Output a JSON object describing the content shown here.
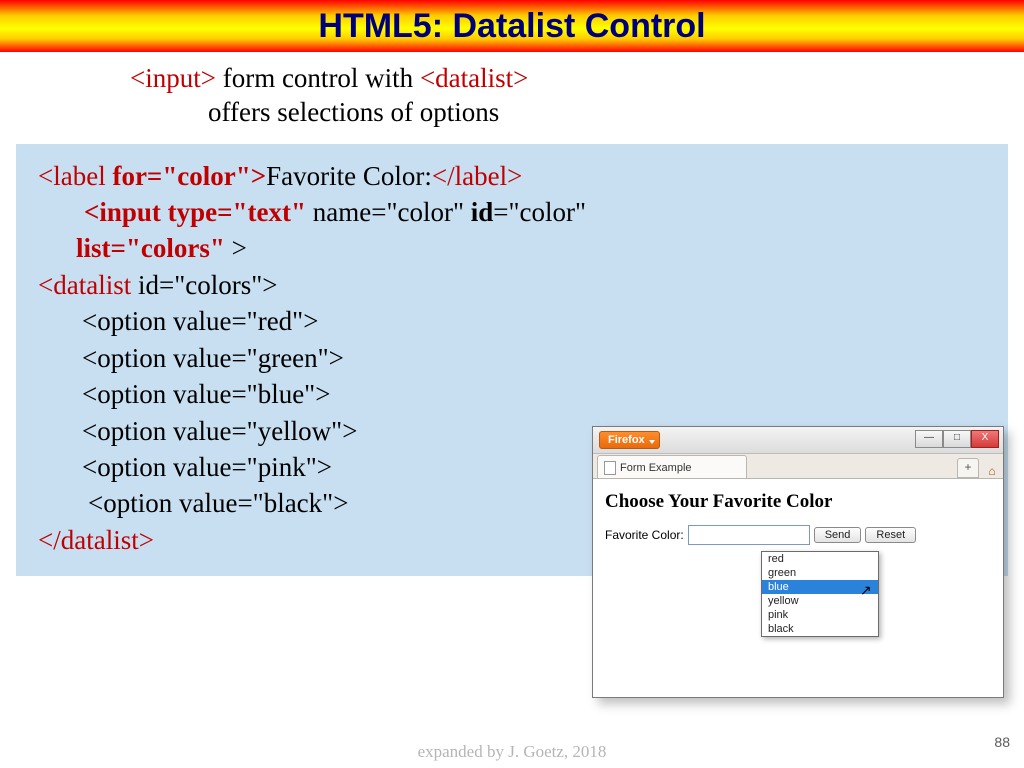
{
  "title": "HTML5: Datalist Control",
  "subtitle": {
    "pre": "<input>",
    "mid1": " form control with ",
    "tag2": "<datalist>",
    "line2": "offers selections of options"
  },
  "code": {
    "l1a": "<label",
    "l1b": " for=\"color\">",
    "l1c": "Favorite Color:",
    "l1d": "</label>",
    "l2a": "<input type=\"text\"",
    "l2b": " name=\"color\" ",
    "l2c": "id",
    "l2d": "=\"color\" ",
    "l3a": "list=\"colors\"",
    "l3b": " >",
    "l4a": "<datalist",
    "l4b": " id=\"colors\">",
    "opt1": "<option value=\"red\">",
    "opt2": "<option value=\"green\">",
    "opt3": "<option value=\"blue\">",
    "opt4": "<option value=\"yellow\">",
    "opt5": "<option value=\"pink\">",
    "opt6": "<option value=\"black\">",
    "close": "</datalist>"
  },
  "window": {
    "app": "Firefox",
    "tab": "Form Example",
    "plus": "+",
    "min": "—",
    "max": "□",
    "close": "X",
    "heading": "Choose Your Favorite Color",
    "label": "Favorite Color:",
    "send": "Send",
    "reset": "Reset",
    "options": {
      "o1": "red",
      "o2": "green",
      "o3": "blue",
      "o4": "yellow",
      "o5": "pink",
      "o6": "black"
    }
  },
  "footer": "expanded  by J. Goetz, 2018",
  "page": "88"
}
